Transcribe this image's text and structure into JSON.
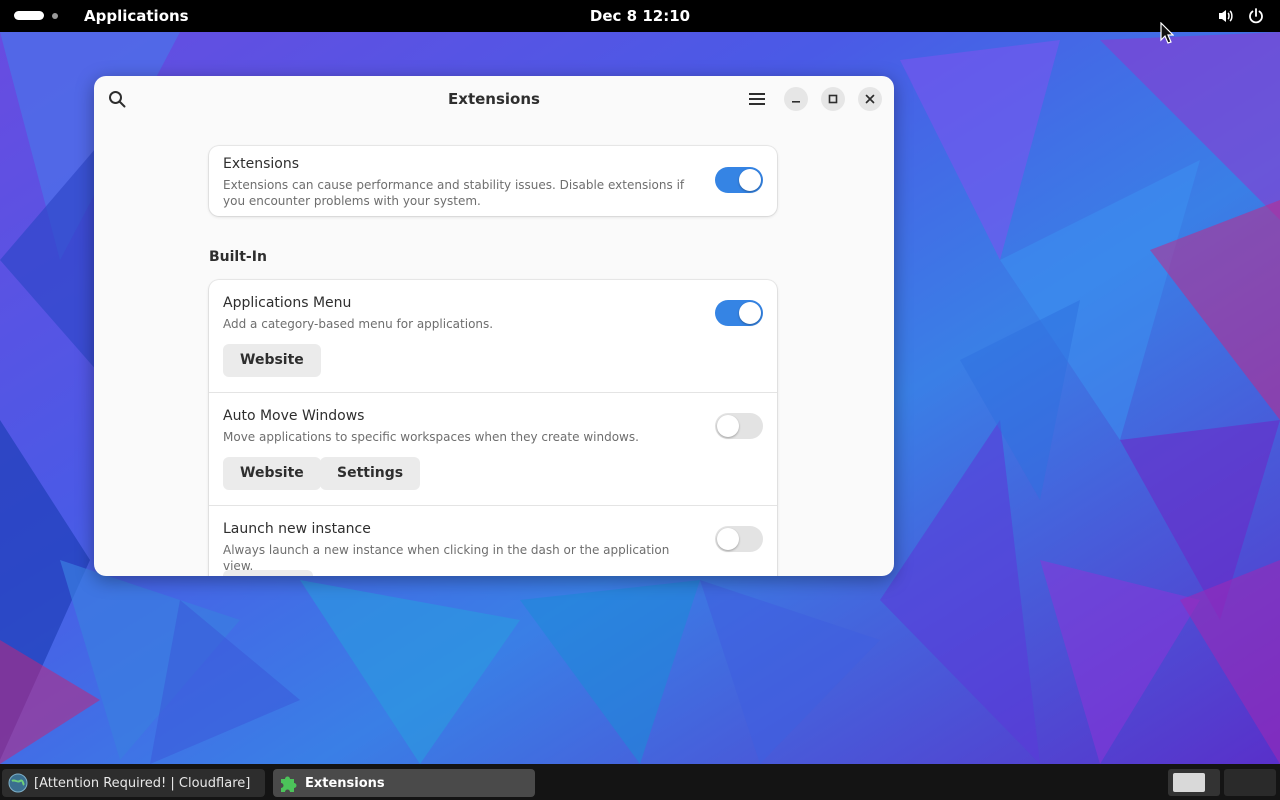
{
  "topbar": {
    "activities_label": "Applications",
    "clock": "Dec 8  12:10",
    "icons": [
      "volume-icon",
      "power-icon"
    ]
  },
  "window": {
    "title": "Extensions",
    "icons": [
      "search-icon",
      "hamburger-menu-icon",
      "minimize-icon",
      "maximize-icon",
      "close-icon"
    ],
    "global": {
      "title": "Extensions",
      "description": "Extensions can cause performance and stability issues. Disable extensions if you encounter problems with your system.",
      "enabled": true
    },
    "section_title": "Built-In",
    "extensions": [
      {
        "name": "Applications Menu",
        "description": "Add a category-based menu for applications.",
        "enabled": true,
        "buttons": [
          "Website"
        ]
      },
      {
        "name": "Auto Move Windows",
        "description": "Move applications to specific workspaces when they create windows.",
        "enabled": false,
        "buttons": [
          "Website",
          "Settings"
        ]
      },
      {
        "name": "Launch new instance",
        "description": "Always launch a new instance when clicking in the dash or the application view.",
        "enabled": false,
        "buttons": []
      }
    ]
  },
  "taskbar": {
    "tasks": [
      {
        "label": "[Attention Required! | Cloudflare]",
        "icon": "browser-globe-icon"
      },
      {
        "label": "Extensions",
        "icon": "puzzle-piece-icon"
      }
    ]
  },
  "colors": {
    "accent": "#3584e4",
    "topbar": "#000000",
    "window_bg": "#fafafa"
  }
}
